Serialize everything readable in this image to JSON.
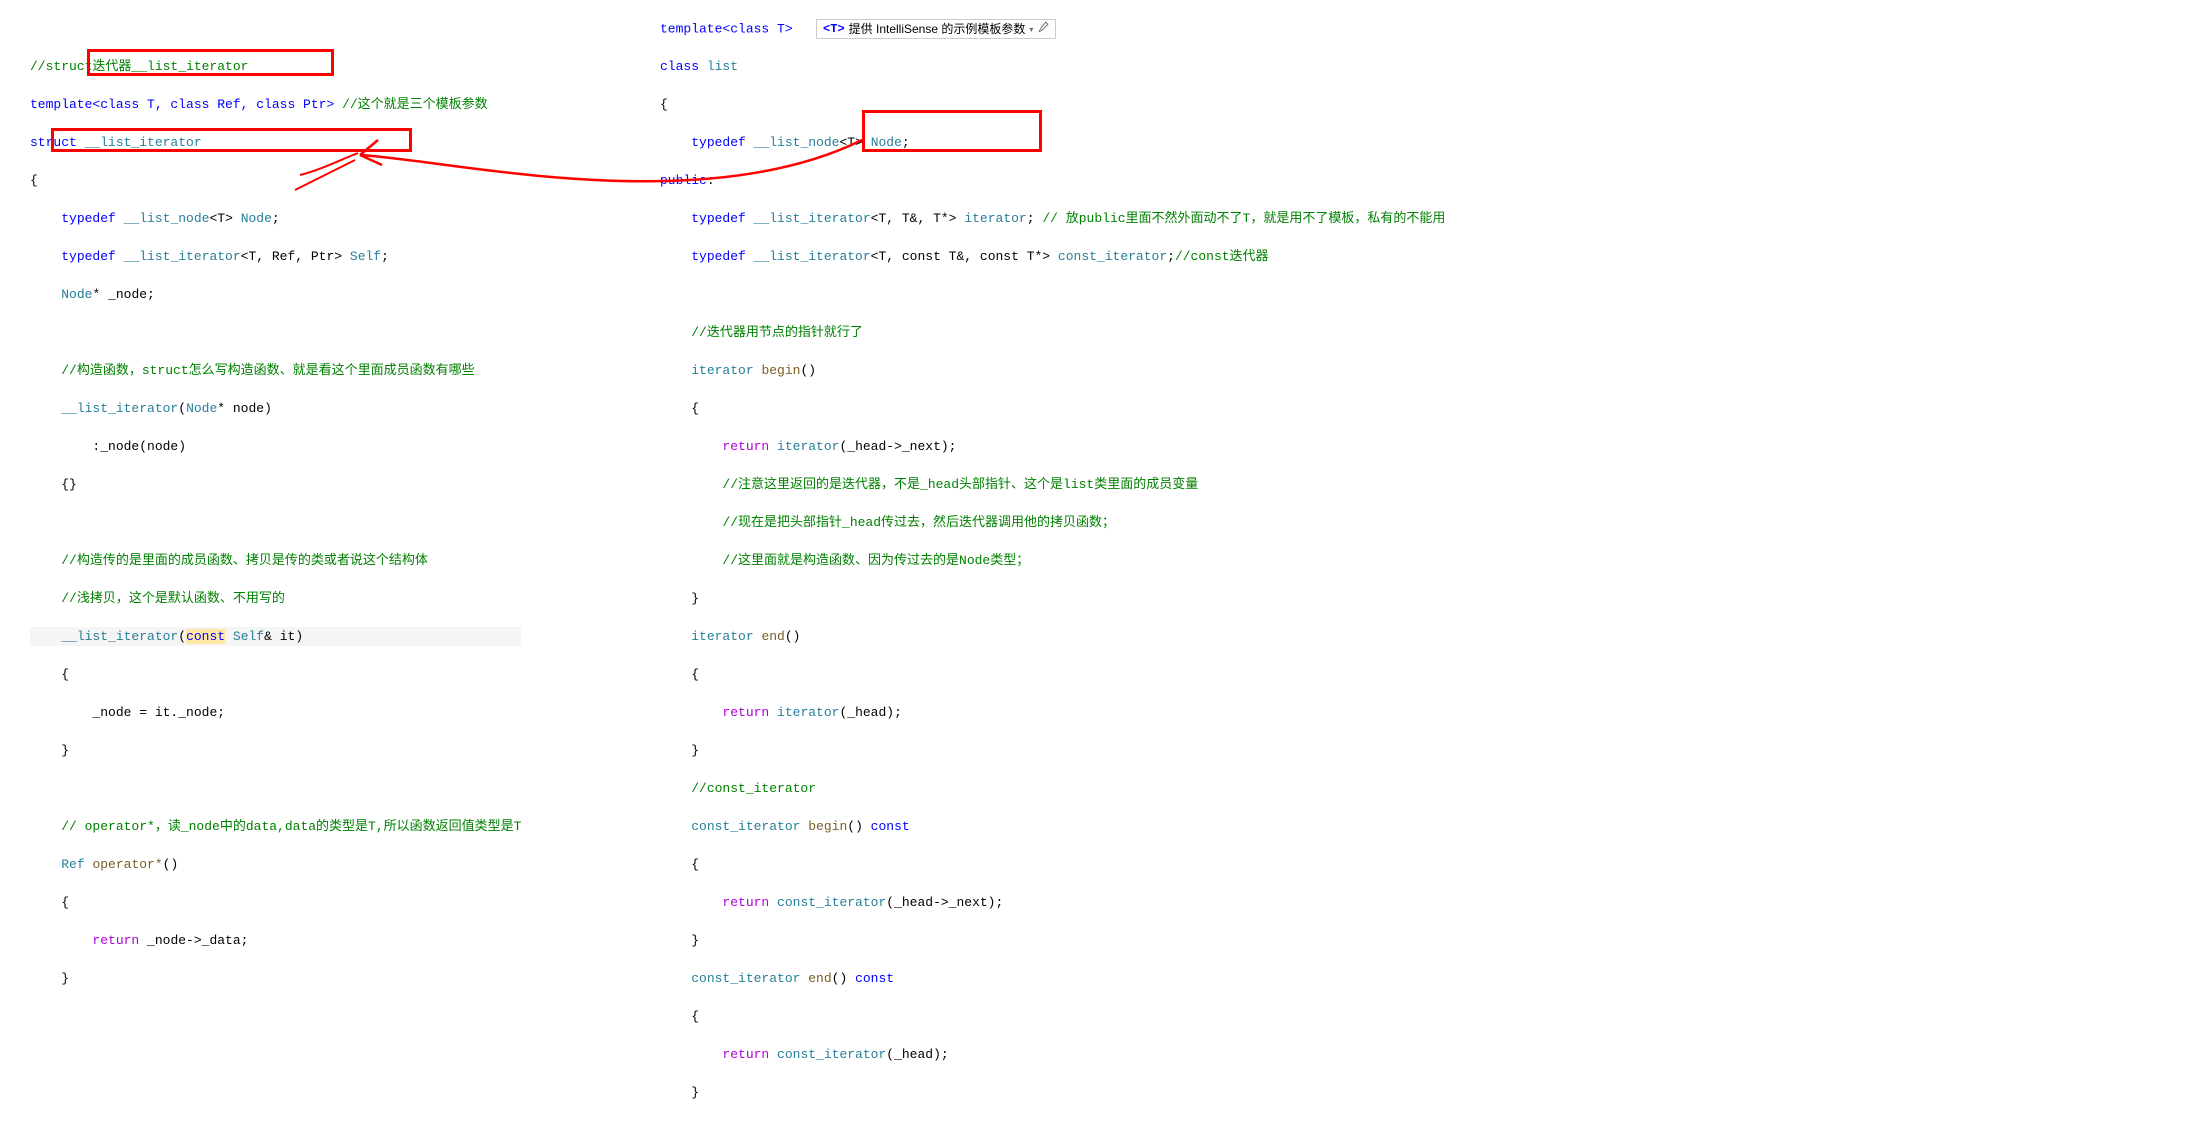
{
  "hint": {
    "key": "<T>",
    "text": "提供 IntelliSense 的示例模板参数"
  },
  "left": {
    "l1_c": "//struct迭代器__list_iterator",
    "l2_a": "template",
    "l2_b": "<class T, class Ref, class Ptr>",
    "l2_c": "//这个就是三个模板参数",
    "l3_a": "struct ",
    "l3_b": "__list_iterator",
    "l5_a": "typedef",
    "l5_b": "__list_node",
    "l5_c": "<T>",
    "l5_d": "Node",
    "l6_a": "typedef",
    "l6_b": "__list_iterator",
    "l6_c": "<T, Ref, Ptr>",
    "l6_d": "Self",
    "l7_a": "Node",
    "l7_b": "* _node;",
    "c1": "//构造函数，struct怎么写构造函数、就是看这个里面成员函数有哪些",
    "ctor": "__list_iterator",
    "ctor_p1": "Node",
    "ctor_p2": "* node",
    "init": ":_node(node)",
    "c2": "//构造传的是里面的成员函数、拷贝是传的类或者说这个结构体",
    "c3": "//浅拷贝，这个是默认函数、不用写的",
    "copy_ctor": "__list_iterator",
    "copy_p1": "const",
    "copy_p2": "Self",
    "copy_p3": "& it",
    "copy_body": "_node = it._node;",
    "c4_a": "// operator*，读_node中的data,data的类型是T,所以函数返回值类型是T",
    "op_ret": "Ref",
    "op_name": "operator*",
    "op_body_a": "return",
    "op_body_b": "_node->_data;"
  },
  "right": {
    "l1_a": "template",
    "l1_b": "<class T>",
    "l2_a": "class ",
    "l2_b": "list",
    "td1_a": "typedef",
    "td1_b": "__list_node",
    "td1_c": "<T>",
    "td1_d": "Node",
    "pub": "public",
    "td2_a": "typedef",
    "td2_b": "__list_iterator",
    "td2_c": "<T, T&, T*>",
    "td2_d": "iterator",
    "td2_e": "// 放public里面不然外面动不了T，就是用不了模板，私有的不能用",
    "td3_a": "typedef",
    "td3_b": "__list_iterator",
    "td3_c": "<T, const T&, const T*>",
    "td3_d": "const_iterator",
    "td3_e": "//const迭代器",
    "c1": "//迭代器用节点的指针就行了",
    "beg_ret": "iterator",
    "beg_name": "begin",
    "beg_body_a": "return",
    "beg_body_b": "iterator",
    "beg_body_c": "(_head->_next);",
    "c2": "//注意这里返回的是迭代器，不是_head头部指针、这个是list类里面的成员变量",
    "c3": "//现在是把头部指针_head传过去，然后迭代器调用他的拷贝函数；",
    "c4": "//这里面就是构造函数、因为传过去的是Node类型；",
    "end_ret": "iterator",
    "end_name": "end",
    "end_body_a": "return",
    "end_body_b": "iterator",
    "end_body_c": "(_head);",
    "c5": "//const_iterator",
    "cbeg_ret": "const_iterator",
    "cbeg_name": "begin",
    "cbeg_q": "const",
    "cbeg_body_a": "return",
    "cbeg_body_b": "const_iterator",
    "cbeg_body_c": "(_head->_next);",
    "cend_ret": "const_iterator",
    "cend_name": "end",
    "cend_q": "const",
    "cend_body_a": "return",
    "cend_body_b": "const_iterator",
    "cend_body_c": "(_head);"
  }
}
